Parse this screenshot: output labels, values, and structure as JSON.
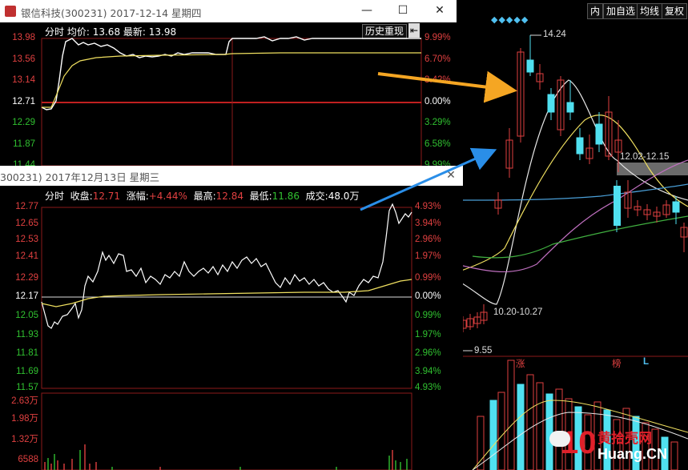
{
  "right_chart": {
    "toolbar": [
      "内",
      "加自选",
      "均线",
      "复权"
    ],
    "high_label": "14.24",
    "low_label": "9.55",
    "range_label_1": "10.20-10.27",
    "range_label_2": "12.02-12.15",
    "tag_zhang": "涨",
    "tag_bang": "榜",
    "tag_l": "L",
    "watermark_main": "Huang.CN",
    "watermark_sub": "黄拾壳网",
    "watermark_big": "10"
  },
  "win_top": {
    "title": "银信科技(300231) 2017-12-14 星期四",
    "minimize": "—",
    "maximize": "☐",
    "close": "✕",
    "info": {
      "fenshi": "分时",
      "avg_label": "均价:",
      "avg_value": "13.68",
      "latest_label": "最新:",
      "latest_value": "13.98"
    },
    "history_button": "历史重现",
    "collapse_icon": "⇤",
    "left_axis": [
      "13.98",
      "13.56",
      "13.14",
      "12.71",
      "12.29",
      "11.87",
      "11.44"
    ],
    "right_axis": [
      "9.99%",
      "6.70%",
      "3.42%",
      "0.00%",
      "3.29%",
      "6.58%",
      "9.99%"
    ]
  },
  "win_bottom": {
    "title": "300231) 2017年12月13日 星期三",
    "close": "✕",
    "info": {
      "fenshi": "分时",
      "close_label": "收盘:",
      "close_value": "12.71",
      "change_label": "涨幅:",
      "change_value": "+4.44%",
      "high_label": "最高:",
      "high_value": "12.84",
      "low_label": "最低:",
      "low_value": "11.86",
      "volume_label": "成交:",
      "volume_value": "48.0万"
    },
    "left_axis": [
      "12.77",
      "12.65",
      "12.53",
      "12.41",
      "12.29",
      "12.17",
      "12.05",
      "11.93",
      "11.81",
      "11.69",
      "11.57"
    ],
    "right_axis": [
      "4.93%",
      "3.94%",
      "2.96%",
      "1.97%",
      "0.99%",
      "0.00%",
      "0.99%",
      "1.97%",
      "2.96%",
      "3.94%",
      "4.93%"
    ],
    "volume_axis": [
      "2.63万",
      "1.98万",
      "1.32万",
      "6588"
    ]
  },
  "colors": {
    "up": "#e04040",
    "down": "#30c030",
    "yellow": "#f0e060",
    "cyan": "#50e0f0",
    "orange_arrow": "#f5a623",
    "blue_arrow": "#2a8ee8"
  }
}
